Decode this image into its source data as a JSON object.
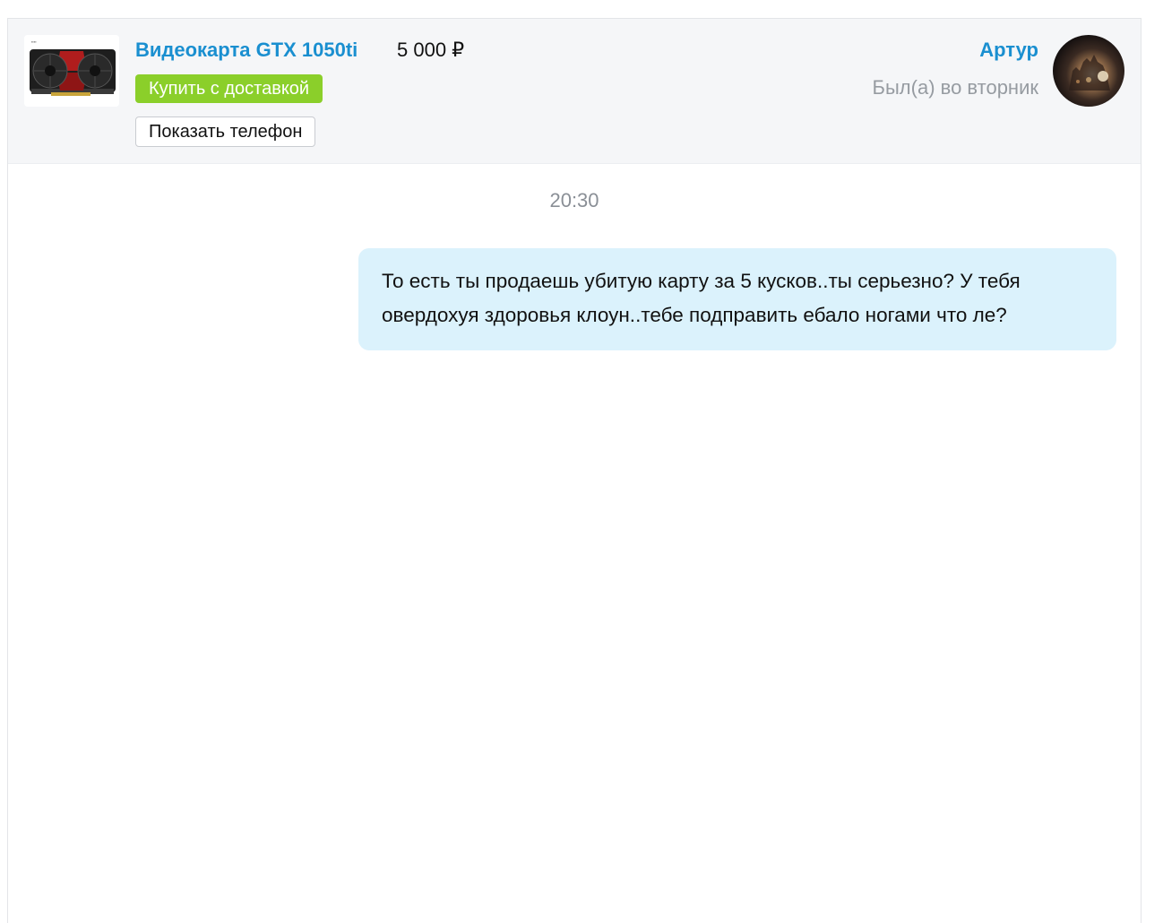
{
  "product": {
    "title": "Видеокарта GTX 1050ti",
    "price": "5 000 ₽",
    "buy_button_label": "Купить с доставкой",
    "phone_button_label": "Показать телефон",
    "thumbnail_icon": "graphics-card-image"
  },
  "user": {
    "name": "Артур",
    "status": "Был(а) во вторник",
    "avatar_icon": "user-avatar-photo"
  },
  "conversation": {
    "timestamp": "20:30",
    "messages": [
      {
        "text": "То есть ты продаешь убитую карту за 5 кусков..ты серьезно? У тебя овердохуя здоровья клоун..тебе подправить ебало ногами что ле?",
        "outgoing": true
      }
    ]
  },
  "colors": {
    "link": "#1a8fd0",
    "buy_button": "#8bcf2a",
    "header_bg": "#f5f6f8",
    "bubble_bg": "#dbf2fc",
    "muted_text": "#969ba1"
  }
}
